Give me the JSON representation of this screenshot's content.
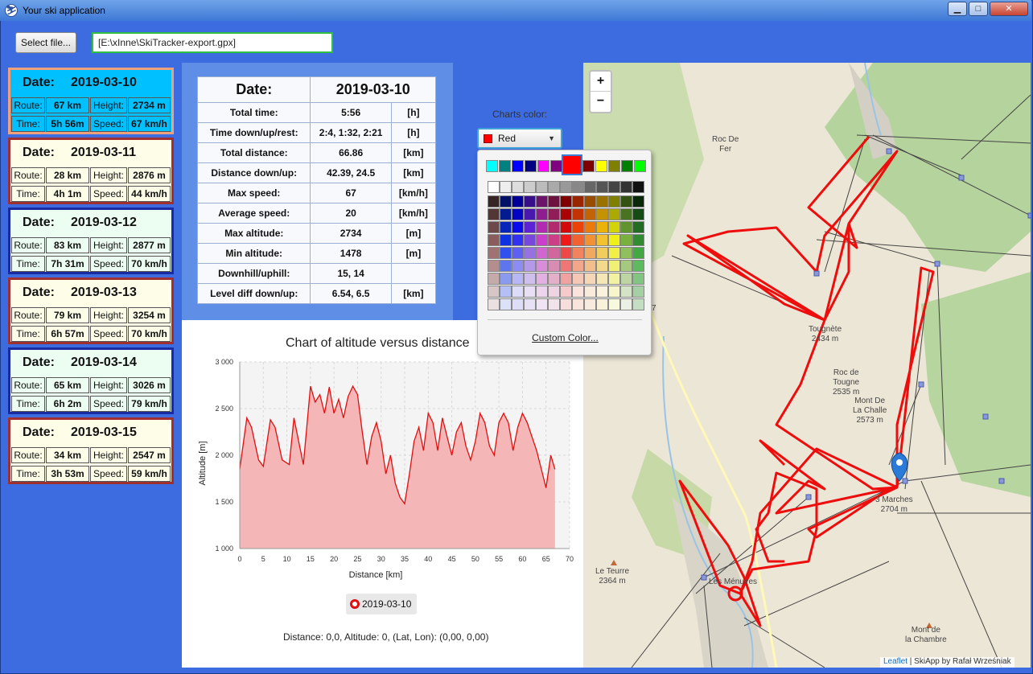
{
  "window": {
    "title": "Your ski application",
    "minimize_glyph": "▁",
    "maximize_glyph": "□",
    "close_glyph": "✕"
  },
  "toolbar": {
    "select_label": "Select file...",
    "file_path": "[E:\\xInne\\SkiTracker-export.gpx]"
  },
  "days": [
    {
      "date": "2019-03-10",
      "route": "67 km",
      "height": "2734 m",
      "time": "5h 56m",
      "speed": "67 km/h",
      "border": "#f0a07a",
      "bg": "#00c0ff"
    },
    {
      "date": "2019-03-11",
      "route": "28 km",
      "height": "2876 m",
      "time": "4h 1m",
      "speed": "44 km/h",
      "border": "#a03030",
      "bg": "#fdfde8"
    },
    {
      "date": "2019-03-12",
      "route": "83 km",
      "height": "2877 m",
      "time": "7h 31m",
      "speed": "70 km/h",
      "border": "#1a2aa0",
      "bg": "#ecfdf2"
    },
    {
      "date": "2019-03-13",
      "route": "79 km",
      "height": "3254 m",
      "time": "6h 57m",
      "speed": "70 km/h",
      "border": "#a03030",
      "bg": "#fdfde8"
    },
    {
      "date": "2019-03-14",
      "route": "65 km",
      "height": "3026 m",
      "time": "6h 2m",
      "speed": "79 km/h",
      "border": "#1a2aa0",
      "bg": "#ecfdf2"
    },
    {
      "date": "2019-03-15",
      "route": "34 km",
      "height": "2547 m",
      "time": "3h 53m",
      "speed": "59 km/h",
      "border": "#a03030",
      "bg": "#fdfde8"
    }
  ],
  "card_labels": {
    "date": "Date:",
    "route": "Route:",
    "height": "Height:",
    "time": "Time:",
    "speed": "Speed:"
  },
  "stats": {
    "header_label": "Date:",
    "header_value": "2019-03-10",
    "rows": [
      {
        "label": "Total time:",
        "value": "5:56",
        "unit": "[h]"
      },
      {
        "label": "Time down/up/rest:",
        "value": "2:4, 1:32, 2:21",
        "unit": "[h]"
      },
      {
        "label": "Total distance:",
        "value": "66.86",
        "unit": "[km]"
      },
      {
        "label": "Distance down/up:",
        "value": "42.39, 24.5",
        "unit": "[km]"
      },
      {
        "label": "Max speed:",
        "value": "67",
        "unit": "[km/h]"
      },
      {
        "label": "Average speed:",
        "value": "20",
        "unit": "[km/h]"
      },
      {
        "label": "Max altitude:",
        "value": "2734",
        "unit": "[m]"
      },
      {
        "label": "Min altitude:",
        "value": "1478",
        "unit": "[m]"
      },
      {
        "label": "Downhill/uphill:",
        "value": "15, 14",
        "unit": ""
      },
      {
        "label": "Level diff down/up:",
        "value": "6.54, 6.5",
        "unit": "[km]"
      }
    ]
  },
  "chart_data": {
    "type": "area",
    "title": "Chart of altitude versus distance",
    "xlabel": "Distance [km]",
    "ylabel": "Altitude [m]",
    "xlim": [
      0,
      70
    ],
    "ylim": [
      1000,
      3000
    ],
    "x_ticks": [
      "0",
      "5",
      "10",
      "15",
      "20",
      "25",
      "30",
      "35",
      "40",
      "45",
      "50",
      "55",
      "60",
      "65",
      "70"
    ],
    "y_ticks": [
      "1 000",
      "1 500",
      "2 000",
      "2 500",
      "3 000"
    ],
    "grid": true,
    "legend_position": "bottom",
    "series": [
      {
        "name": "2019-03-10",
        "color": "#e01010",
        "fill": "#f4b6b6",
        "x": [
          0,
          1.5,
          2.5,
          4,
          5,
          6.5,
          7.5,
          9,
          10.5,
          11.5,
          12.5,
          13.5,
          15,
          16,
          17,
          18,
          19,
          20,
          21,
          22,
          23,
          24,
          25,
          26,
          27,
          28,
          29,
          30,
          31,
          32,
          33,
          34,
          35,
          36,
          37,
          38,
          39,
          40,
          41,
          42,
          43,
          44,
          45,
          46,
          47,
          48,
          49,
          50,
          51,
          52,
          53,
          54,
          55,
          56,
          57,
          58,
          59,
          60,
          61,
          62,
          63,
          64,
          65,
          66,
          66.9
        ],
        "y": [
          1850,
          2400,
          2300,
          1950,
          1880,
          2380,
          2300,
          1950,
          1900,
          2400,
          2150,
          1900,
          2740,
          2570,
          2650,
          2450,
          2730,
          2450,
          2600,
          2400,
          2630,
          2740,
          2650,
          2250,
          1900,
          2200,
          2350,
          2150,
          1800,
          2000,
          1700,
          1550,
          1480,
          1800,
          2150,
          2300,
          2050,
          2450,
          2350,
          2050,
          2400,
          2200,
          2000,
          2250,
          2350,
          2100,
          1950,
          2150,
          2450,
          2350,
          2100,
          2000,
          2350,
          2450,
          2350,
          2050,
          2300,
          2450,
          2350,
          2200,
          2050,
          1850,
          1650,
          2000,
          1850
        ]
      }
    ],
    "status": "Distance: 0,0, Altitude: 0, (Lat, Lon): (0,00, 0,00)"
  },
  "color_picker": {
    "label": "Charts color:",
    "selected": "Red",
    "selected_color": "#ff0000",
    "arrow": "▼",
    "custom_label": "Custom Color...",
    "recent": [
      "#00ffff",
      "#008080",
      "#0000ff",
      "#000080",
      "#ff00ff",
      "#800080",
      "#800000",
      "#ffff00",
      "#808000",
      "#008000",
      "#00ff00"
    ],
    "grays": [
      "#ffffff",
      "#eeeeee",
      "#dddddd",
      "#cccccc",
      "#bbbbbb",
      "#aaaaaa",
      "#999999",
      "#888888",
      "#666666",
      "#555555",
      "#444444",
      "#333333",
      "#111111"
    ]
  },
  "map": {
    "zoom_in": "+",
    "zoom_out": "−",
    "attribution_link": "Leaflet",
    "attribution_text": " | SkiApp by Rafał Wrześniak",
    "labels": {
      "roc_de_fer": "Roc De\nFer",
      "tougnete": "Tougnète\n2434 m",
      "roc_de_tougne": "Roc de\nTougne\n2535 m",
      "mont_de_la_challe": "Mont De\nLa Challe\n2573 m",
      "trois_marches": "3 Marches\n2704 m",
      "le_teurre": "Le Teurre\n2364 m",
      "les_menuires": "Les Ménuires",
      "mont_de_la_chambre": "Mont de\nla Chambre",
      "road_number": "7"
    }
  }
}
